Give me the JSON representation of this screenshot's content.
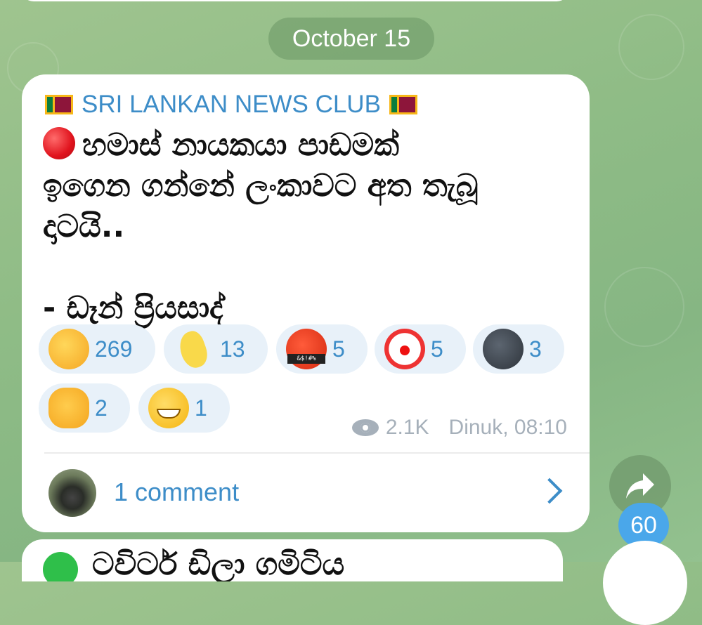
{
  "date_separator": "October 15",
  "post": {
    "channel_name": "SRI LANKAN NEWS CLUB",
    "flag_icon": "sri-lanka-flag-icon",
    "status_icon": "red-circle-icon",
    "text_lines": [
      "හමාස් නායකයා පාඩමක්",
      "ඉගෙන ගන්නේ ලංකාවට අත තැබූ",
      "දාටයි.."
    ],
    "author_line": "- ඩෑන් ප්‍රියසාද්",
    "reactions": [
      {
        "icon": "rolling-on-floor-laughing-icon",
        "count": "269"
      },
      {
        "icon": "banana-icon",
        "count": "13"
      },
      {
        "icon": "cursing-face-icon",
        "count": "5"
      },
      {
        "icon": "clown-face-icon",
        "count": "5"
      },
      {
        "icon": "new-moon-face-icon",
        "count": "3"
      },
      {
        "icon": "clapping-hands-icon",
        "count": "2"
      },
      {
        "icon": "grinning-face-icon",
        "count": "1"
      }
    ],
    "views": "2.1K",
    "author_time": "Dinuk, 08:10",
    "comments_label": "1 comment"
  },
  "share_badge": "60",
  "next_post_preview": "ටවිටර් ඩිලා ගමිටිය",
  "colors": {
    "accent": "#3d8dc8",
    "badge": "#4aa7ea",
    "reaction_bg": "#e8f1f9",
    "meta": "#a6b0ba"
  }
}
